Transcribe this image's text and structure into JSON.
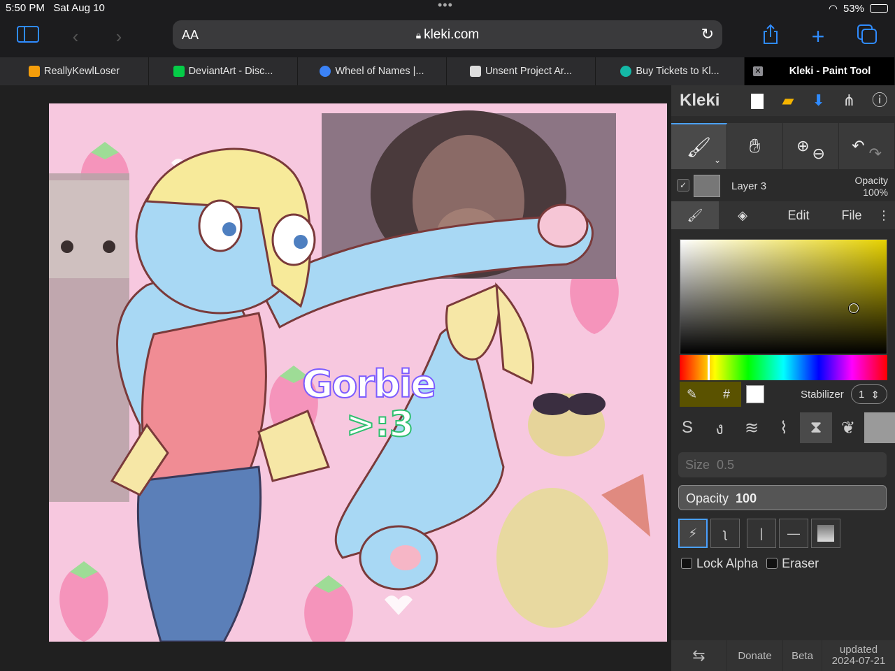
{
  "status_bar": {
    "time": "5:50 PM",
    "date": "Sat Aug 10",
    "battery": "53%",
    "battery_level": 0.53
  },
  "browser": {
    "text_size_label": "AA",
    "url": "kleki.com",
    "tabs": [
      {
        "title": "ReallyKewlLoser",
        "favicon_color": "#f59e0b"
      },
      {
        "title": "DeviantArt - Disc...",
        "favicon_color": "#05cc47"
      },
      {
        "title": "Wheel of Names |...",
        "favicon_color": "#3b82f6"
      },
      {
        "title": "Unsent Project Ar...",
        "favicon_color": "#dddddd"
      },
      {
        "title": "Buy Tickets to Kl...",
        "favicon_color": "#14b8a6"
      },
      {
        "title": "Kleki - Paint Tool",
        "active": true
      }
    ]
  },
  "canvas": {
    "doodle_text_1": "Gorbie",
    "doodle_text_2": ">:3"
  },
  "kleki": {
    "logo": "Kleki",
    "layer": {
      "name": "Layer 3",
      "opacity_label": "Opacity",
      "opacity_value": "100%"
    },
    "subtabs": {
      "edit": "Edit",
      "file": "File"
    },
    "color": {
      "hash": "#",
      "stabilizer_label": "Stabilizer",
      "stabilizer_value": "1"
    },
    "size_label": "Size",
    "size_value": "0.5",
    "opacity_label": "Opacity",
    "opacity_value": "100",
    "lock_alpha": "Lock Alpha",
    "eraser": "Eraser",
    "footer": {
      "donate": "Donate",
      "beta": "Beta",
      "updated_label": "updated",
      "updated_date": "2024-07-21"
    }
  }
}
